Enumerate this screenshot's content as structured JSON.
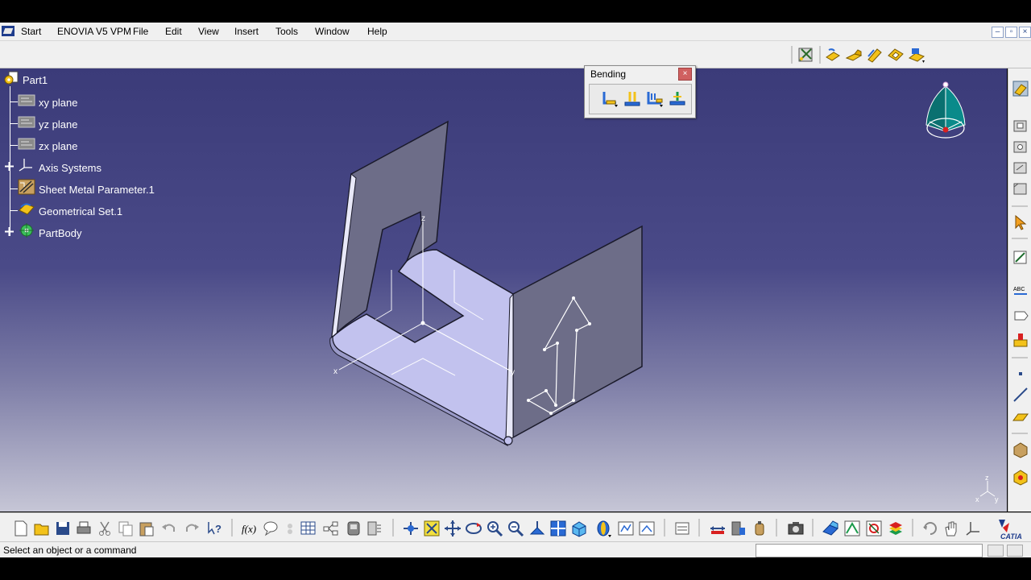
{
  "menubar": {
    "items": [
      "Start",
      "ENOVIA V5 VPM",
      "File",
      "Edit",
      "View",
      "Insert",
      "Tools",
      "Window",
      "Help"
    ],
    "window_buttons": [
      "–",
      "▫",
      "×"
    ]
  },
  "tree": {
    "root": "Part1",
    "items": [
      "xy plane",
      "yz plane",
      "zx plane",
      "Axis Systems",
      "Sheet Metal Parameter.1",
      "Geometrical Set.1",
      "PartBody"
    ]
  },
  "bending_toolbar": {
    "title": "Bending",
    "tools": [
      "bend-icon",
      "bend-from-flat-icon",
      "conical-bend-icon",
      "flat-bend-icon"
    ]
  },
  "viewport": {
    "axis_labels": {
      "x": "x",
      "y": "y",
      "z": "z"
    },
    "compass_axes": {
      "x": "x",
      "y": "y",
      "z": "z"
    },
    "model_color": "#c2c2ee",
    "flange_color": "#6d6d88",
    "background_top": "#3b3b79",
    "background_bottom": "#c6c6d6"
  },
  "status": {
    "text": "Select an object or a command"
  },
  "branding": {
    "logo_text": "CATIA"
  },
  "colors": {
    "ui_background": "#f0f0f0",
    "accent_blue": "#2a6ad4",
    "accent_yellow": "#f3c21a"
  }
}
